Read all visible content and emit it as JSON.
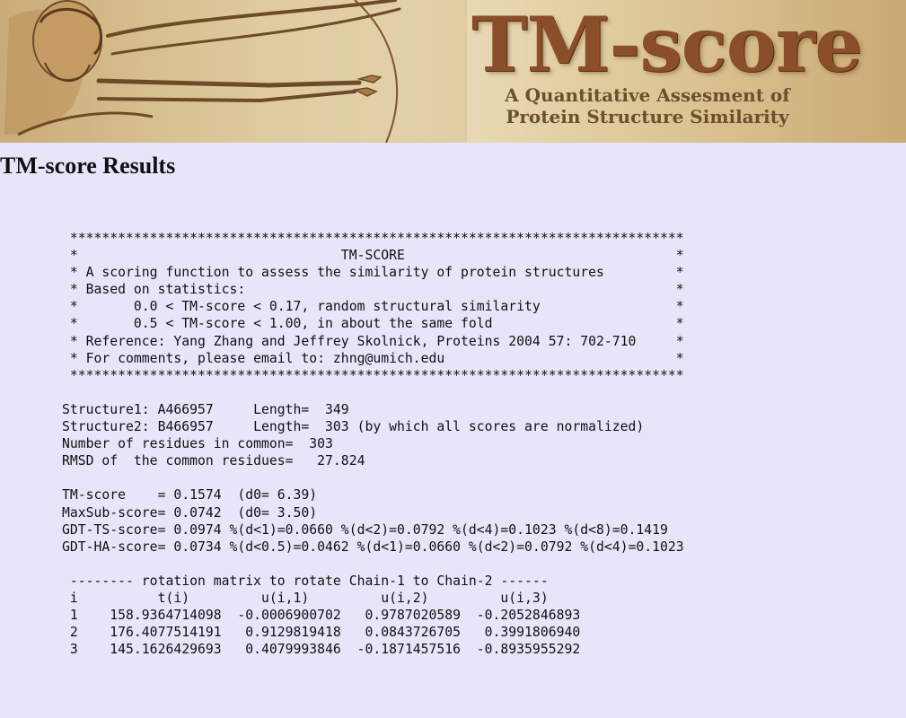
{
  "banner": {
    "logo_title": "TM-score",
    "logo_subtitle_line1": "A Quantitative Assesment of",
    "logo_subtitle_line2": "Protein Structure Similarity"
  },
  "page_title": "TM-score Results",
  "results": {
    "header_box": [
      " *****************************************************************************",
      " *                                 TM-SCORE                                  *",
      " * A scoring function to assess the similarity of protein structures         *",
      " * Based on statistics:                                                      *",
      " *       0.0 < TM-score < 0.17, random structural similarity                 *",
      " *       0.5 < TM-score < 1.00, in about the same fold                       *",
      " * Reference: Yang Zhang and Jeffrey Skolnick, Proteins 2004 57: 702-710     *",
      " * For comments, please email to: zhng@umich.edu                             *",
      " *****************************************************************************"
    ],
    "structure_info": [
      "Structure1: A466957     Length=  349",
      "Structure2: B466957     Length=  303 (by which all scores are normalized)",
      "Number of residues in common=  303",
      "RMSD of  the common residues=   27.824"
    ],
    "scores": [
      "TM-score    = 0.1574  (d0= 6.39)",
      "MaxSub-score= 0.0742  (d0= 3.50)",
      "GDT-TS-score= 0.0974 %(d<1)=0.0660 %(d<2)=0.0792 %(d<4)=0.1023 %(d<8)=0.1419",
      "GDT-HA-score= 0.0734 %(d<0.5)=0.0462 %(d<1)=0.0660 %(d<2)=0.0792 %(d<4)=0.1023"
    ],
    "rotation_matrix": [
      " -------- rotation matrix to rotate Chain-1 to Chain-2 ------",
      " i          t(i)         u(i,1)         u(i,2)         u(i,3)",
      " 1    158.9364714098  -0.0006900702   0.9787020589  -0.2052846893",
      " 2    176.4077514191   0.9129819418   0.0843726705   0.3991806940",
      " 3    145.1626429693   0.4079993846  -0.1871457516  -0.8935955292"
    ]
  }
}
